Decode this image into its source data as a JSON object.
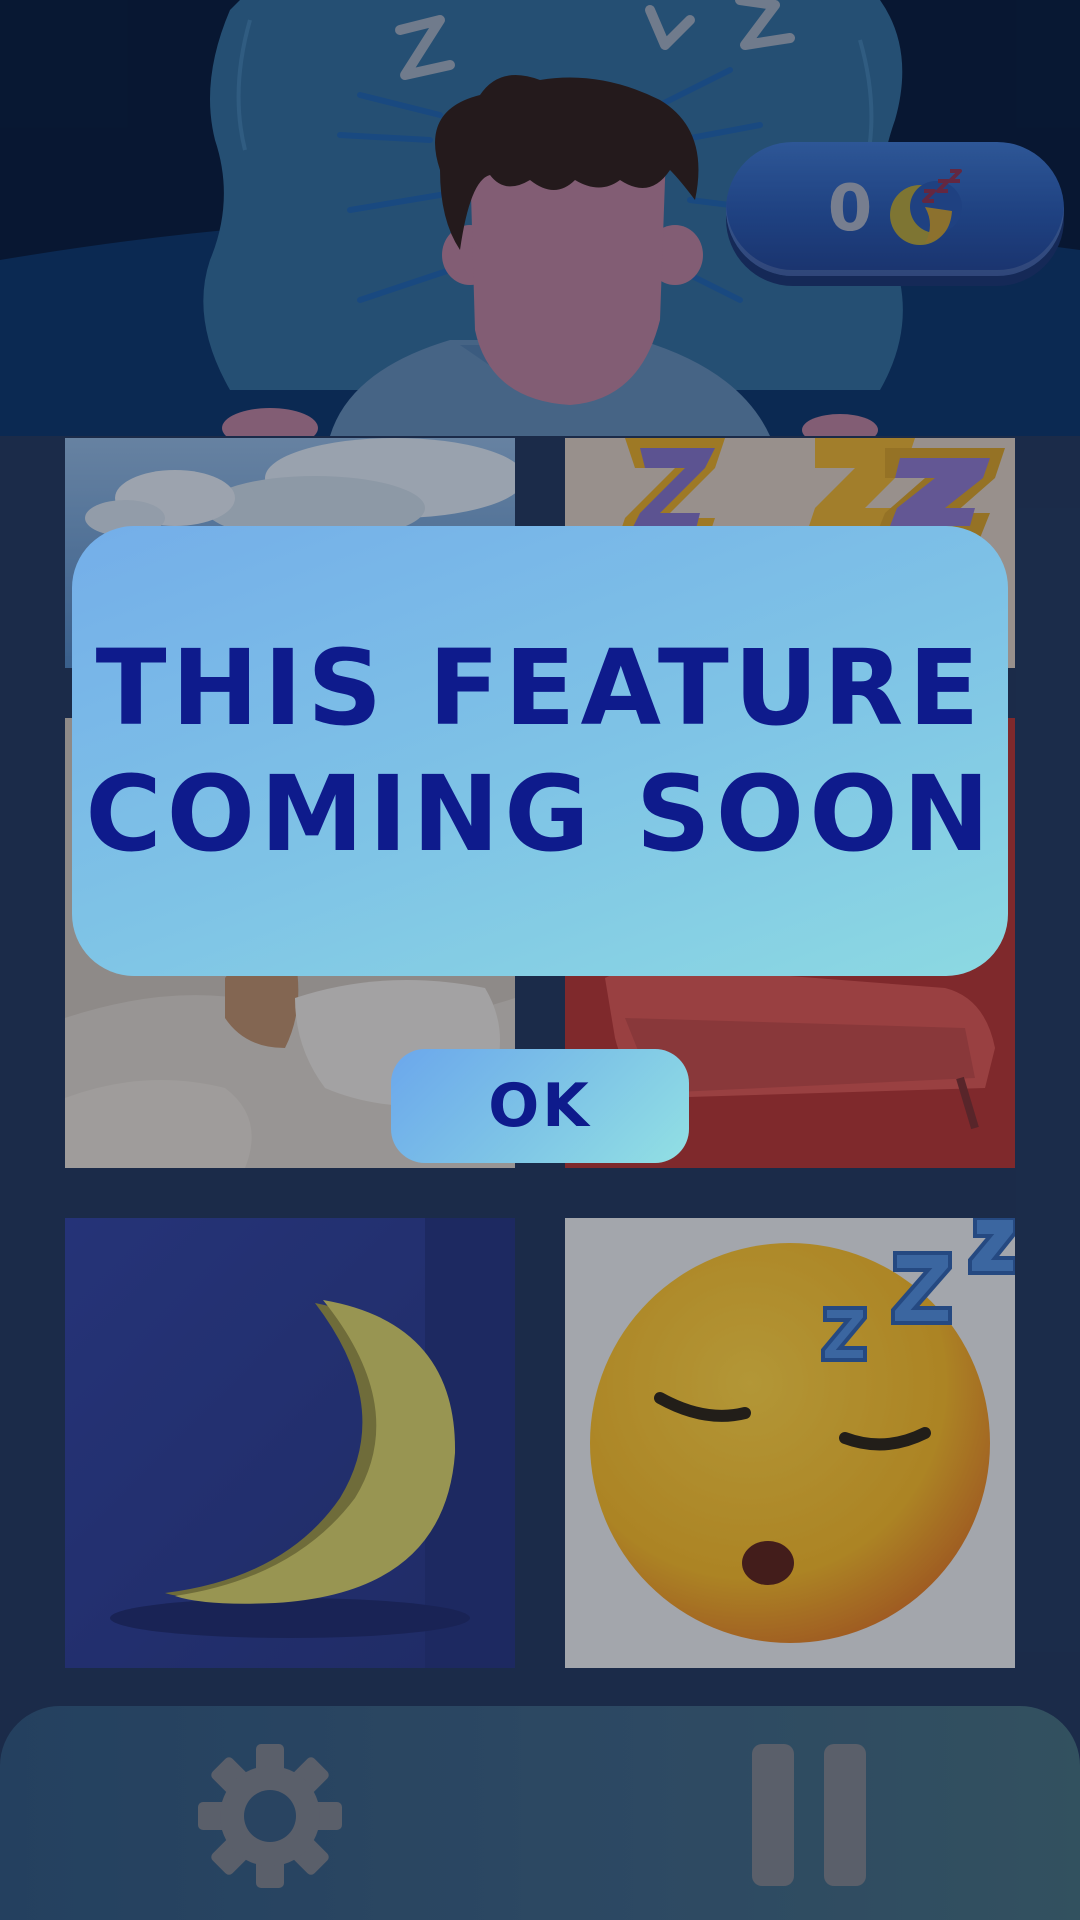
{
  "score": {
    "value": "0",
    "icon": "moon-zzz-icon"
  },
  "grid": {
    "tiles": [
      {
        "name": "clouds-tile",
        "icon": "clouds-image"
      },
      {
        "name": "zzz-letters-tile",
        "icon": "zzz-image"
      },
      {
        "name": "sleeping-person-tile",
        "icon": "sleeping-person-image"
      },
      {
        "name": "red-bed-tile",
        "icon": "bed-image"
      },
      {
        "name": "moon-tile",
        "icon": "crescent-moon-image"
      },
      {
        "name": "sleeping-emoji-tile",
        "icon": "sleeping-emoji-image"
      }
    ]
  },
  "dialog": {
    "line1": "THIS FEATURE",
    "line2": "COMING SOON",
    "ok_label": "OK"
  },
  "bottom_bar": {
    "settings_icon": "gear-icon",
    "pause_icon": "pause-icon"
  },
  "colors": {
    "dialog_text": "#0e1b8c",
    "dialog_bg": "#7fc4e6",
    "pill_bg": "#2553a8"
  }
}
